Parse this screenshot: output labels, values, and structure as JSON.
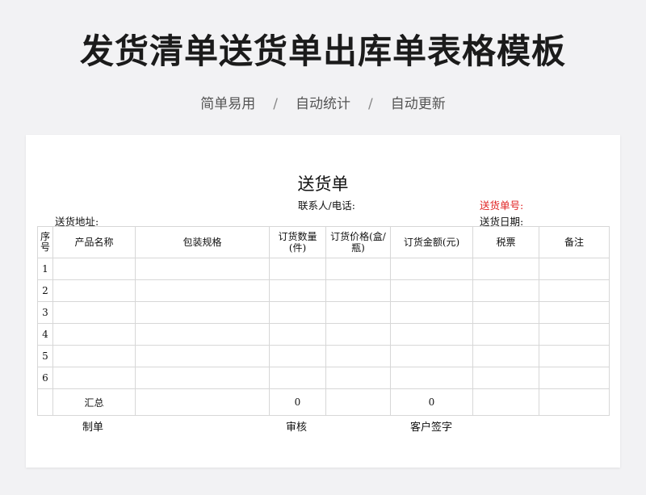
{
  "banner": {
    "title": "发货清单送货单出库单表格模板",
    "subtitle_items": [
      "简单易用",
      "自动统计",
      "自动更新"
    ],
    "separator": "/"
  },
  "document": {
    "title": "送货单",
    "contact_label": "联系人/电话:",
    "order_no_label": "送货单号:",
    "address_label": "送货地址:",
    "date_label": "送货日期:",
    "accent_color": "#e02020"
  },
  "table": {
    "headers": [
      "序号",
      "产品名称",
      "包装规格",
      "订货数量(件)",
      "订货价格(盒/瓶)",
      "订货金额(元)",
      "税票",
      "备注"
    ],
    "rows": [
      [
        "1",
        "",
        "",
        "",
        "",
        "",
        "",
        ""
      ],
      [
        "2",
        "",
        "",
        "",
        "",
        "",
        "",
        ""
      ],
      [
        "3",
        "",
        "",
        "",
        "",
        "",
        "",
        ""
      ],
      [
        "4",
        "",
        "",
        "",
        "",
        "",
        "",
        ""
      ],
      [
        "5",
        "",
        "",
        "",
        "",
        "",
        "",
        ""
      ],
      [
        "6",
        "",
        "",
        "",
        "",
        "",
        "",
        ""
      ]
    ],
    "total_label": "汇总",
    "total_quantity": "0",
    "total_amount": "0"
  },
  "footer": {
    "maker_label": "制单",
    "review_label": "审核",
    "customer_sign_label": "客户签字"
  }
}
